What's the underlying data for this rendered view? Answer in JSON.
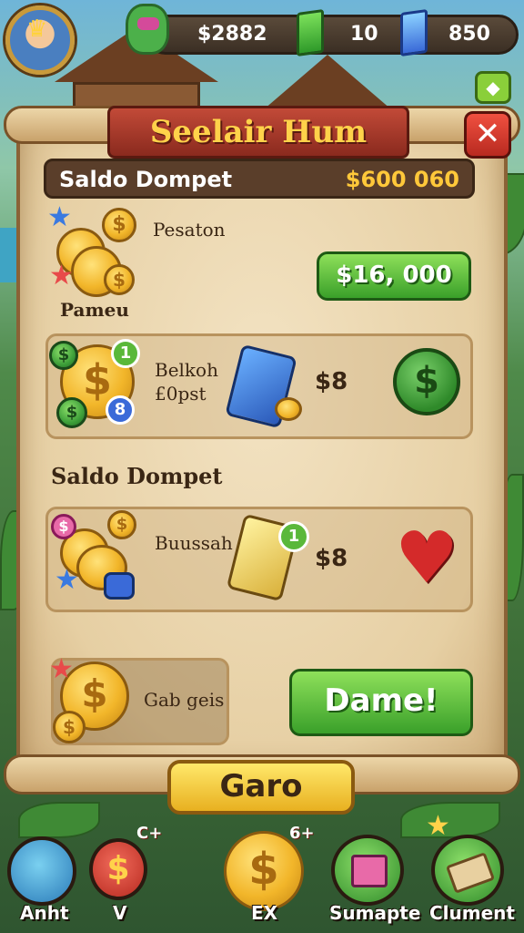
{
  "topbar": {
    "money": "$2882",
    "green_gems": "10",
    "blue_gems": "850"
  },
  "panel": {
    "title": "Seelair Hum",
    "wallet_label": "Saldo Dompet",
    "wallet_value": "$600 060"
  },
  "offers": [
    {
      "title": "Pesaton",
      "icon_label": "Pameu",
      "button_label": "$16, 000"
    },
    {
      "title_line1": "Belkoh",
      "title_line2": "£0pst",
      "price": "$8",
      "badge_top": "1",
      "badge_bottom": "8"
    }
  ],
  "section2": {
    "label": "Saldo Dompet",
    "item_title": "Buussah",
    "price": "$8",
    "badge": "1"
  },
  "bottom_offer": {
    "title": "Gab geis",
    "button_label": "Dame!"
  },
  "main_button": "Garo",
  "nav": [
    {
      "label": "Anht",
      "icon": "narwhal-icon"
    },
    {
      "label": "V",
      "icon": "dollar-coin-icon",
      "extra": "C+"
    },
    {
      "label": "EX",
      "icon": "gold-coin-icon",
      "extra": "6+"
    },
    {
      "label": "Sumapte",
      "icon": "gift-box-icon"
    },
    {
      "label": "Clument",
      "icon": "ticket-icon"
    }
  ],
  "colors": {
    "accent_gold": "#ffd24a",
    "banner_red": "#c24a38",
    "button_green": "#3aa02a",
    "parchment": "#e6cfa3"
  }
}
